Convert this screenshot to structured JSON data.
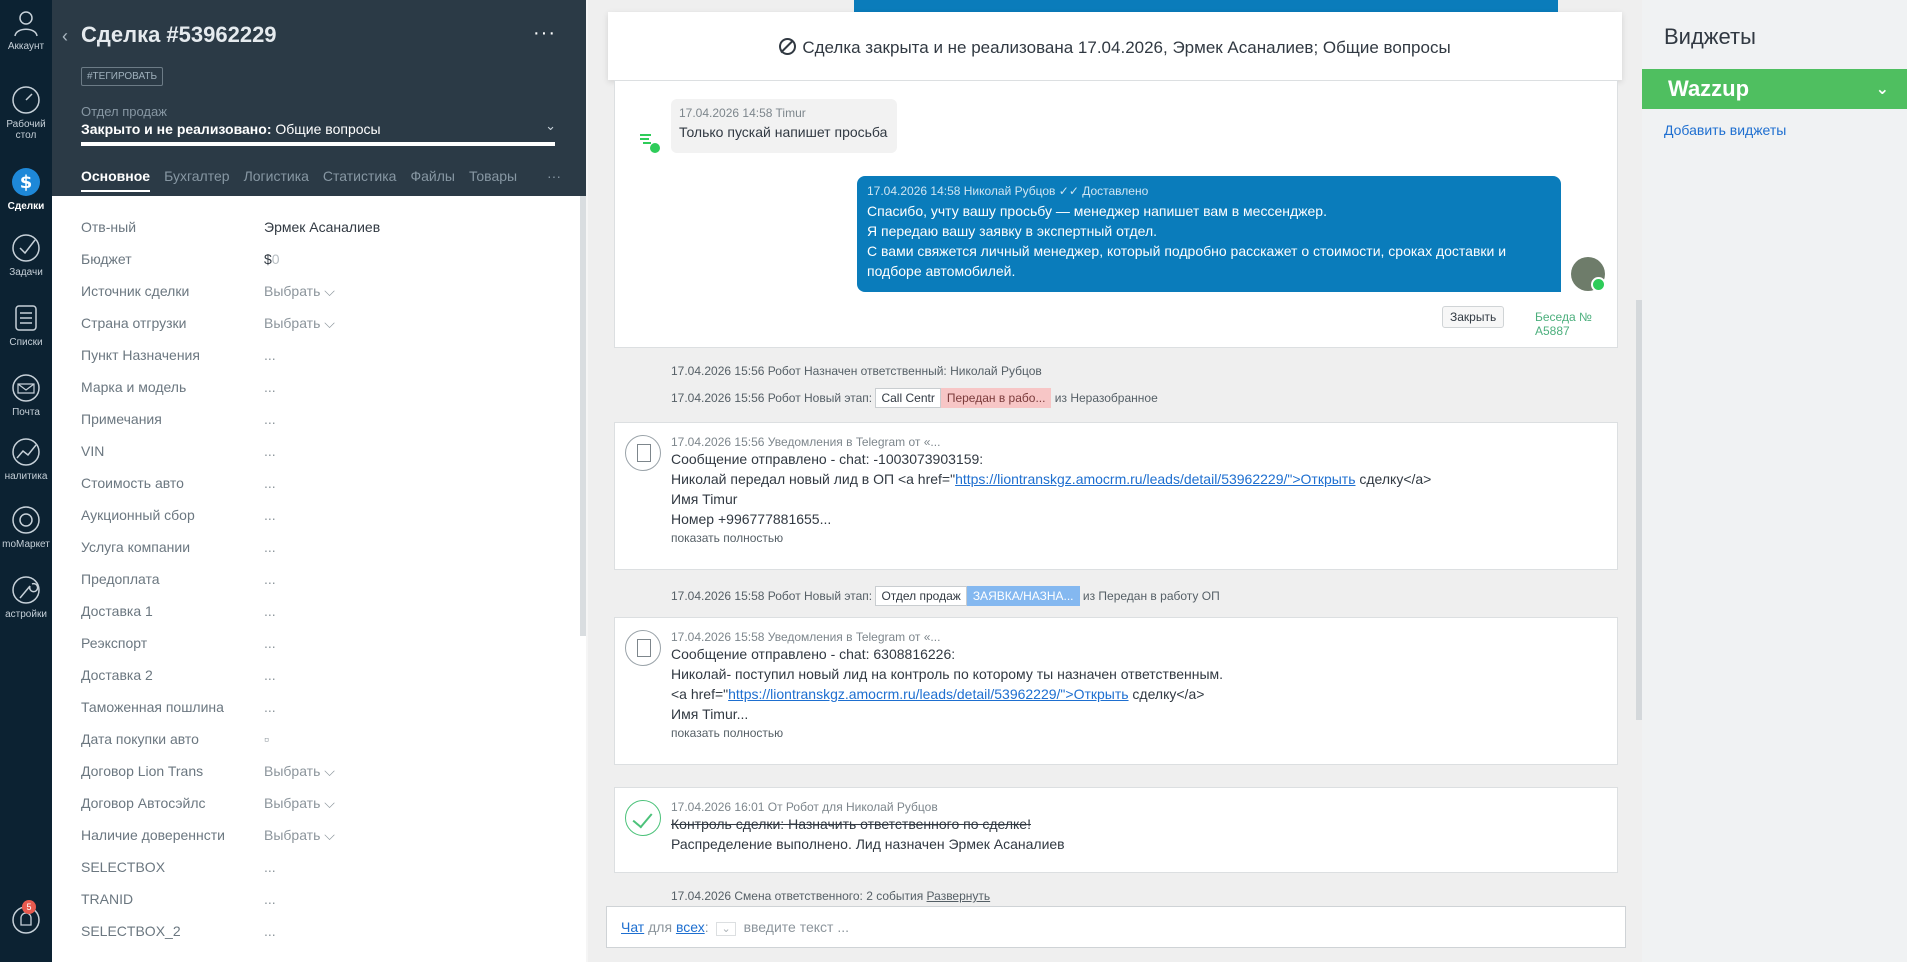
{
  "nav": [
    {
      "label": "Аккаунт",
      "icon": "account-icon"
    },
    {
      "label": "Рабочий стол",
      "icon": "dashboard-icon"
    },
    {
      "label": "Сделки",
      "icon": "deals-icon"
    },
    {
      "label": "Задачи",
      "icon": "tasks-icon"
    },
    {
      "label": "Списки",
      "icon": "lists-icon"
    },
    {
      "label": "Почта",
      "icon": "mail-icon"
    },
    {
      "label": "налитика",
      "icon": "analytics-icon"
    },
    {
      "label": "moМаркет",
      "icon": "market-icon"
    },
    {
      "label": "астройки",
      "icon": "settings-icon"
    }
  ],
  "nav_badge": "5",
  "deal": {
    "title": "Сделка #53962229",
    "more": "···",
    "tag_button": "#ТЕГИРОВАТЬ",
    "pipeline": "Отдел продаж",
    "stage_status": "Закрыто и не реализовано:",
    "stage_reason": " Общие вопросы",
    "tabs": [
      "Основное",
      "Бухгалтер",
      "Логистика",
      "Статистика",
      "Файлы",
      "Товары"
    ],
    "tabs_more": "···",
    "fields": [
      {
        "label": "Отв-ный",
        "value": "Эрмек Асаналиев"
      },
      {
        "label": "Бюджет",
        "value": "$",
        "value_suffix": "0"
      },
      {
        "label": "Источник сделки",
        "value": "Выбрать ⌵"
      },
      {
        "label": "Страна отгрузки",
        "value": "Выбрать ⌵"
      },
      {
        "label": "Пункт Назначения",
        "value": "..."
      },
      {
        "label": "Марка и модель",
        "value": "..."
      },
      {
        "label": "Примечания",
        "value": "..."
      },
      {
        "label": "VIN",
        "value": "..."
      },
      {
        "label": "Стоимость авто",
        "value": "..."
      },
      {
        "label": "Аукционный сбор",
        "value": "..."
      },
      {
        "label": "Услуга компании",
        "value": "..."
      },
      {
        "label": "Предоплата",
        "value": "..."
      },
      {
        "label": "Доставка 1",
        "value": "..."
      },
      {
        "label": "Реэкспорт",
        "value": "..."
      },
      {
        "label": "Доставка 2",
        "value": "..."
      },
      {
        "label": "Таможенная пошлина",
        "value": "..."
      },
      {
        "label": "Дата покупки авто",
        "value": "▫"
      },
      {
        "label": "Договор Lion Trans",
        "value": "Выбрать ⌵"
      },
      {
        "label": "Договор Автосэйлс",
        "value": "Выбрать ⌵"
      },
      {
        "label": "Наличие довереннсти",
        "value": "Выбрать ⌵"
      },
      {
        "label": "SELECTBOX",
        "value": "..."
      },
      {
        "label": "TRANID",
        "value": "..."
      },
      {
        "label": "SELECTBOX_2",
        "value": "..."
      }
    ]
  },
  "feed": {
    "closed_banner": "Сделка закрыта и не реализована 17.04.2026, Эрмек Асаналиев; Общие вопросы",
    "incoming": {
      "meta": "17.04.2026 14:58 Timur",
      "text": "Только пускай напишет просьба"
    },
    "outgoing": {
      "meta": "17.04.2026 14:58 Николай Рубцов ✓✓ Доставлено",
      "lines": [
        "Спасибо, учту вашу просьбу — менеджер напишет вам в мессенджер.",
        "Я передаю вашу заявку в экспертный отдел.",
        "С вами свяжется личный менеджер, который подробно расскажет о стоимости, сроках доставки и",
        "подборе автомобилей."
      ]
    },
    "close_button": "Закрыть",
    "conversation": "Беседа № A5887",
    "sys1": "17.04.2026 15:56 Робот Назначен ответственный: Николай Рубцов",
    "sys2_prefix": "17.04.2026 15:56 Робот Новый этап:",
    "sys2_from_pill": "Call Centr",
    "sys2_to_pill": "Передан в рабо...",
    "sys2_suffix": "из Неразобранное",
    "note1": {
      "meta": "17.04.2026 15:56 Уведомления в Telegram от «...",
      "line1": "Сообщение отправлено - chat: -1003073903159:",
      "line2_pre": "Николай передал новый лид в ОП <a href=\"",
      "line2_link": "https://liontranskgz.amocrm.ru/leads/detail/53962229/\">Открыть",
      "line2_post": " сделку</a>",
      "line3": "Имя Timur",
      "line4": "Номер +996777881655...",
      "show": "показать полностью"
    },
    "sys3_prefix": "17.04.2026 15:58 Робот Новый этап:",
    "sys3_from_pill": "Отдел продаж",
    "sys3_to_pill": "ЗАЯВКА/НАЗНА...",
    "sys3_suffix": "из Передан в работу ОП",
    "note2": {
      "meta": "17.04.2026 15:58 Уведомления в Telegram от «...",
      "line1": "Сообщение отправлено - chat: 6308816226:",
      "line2": "Николай- поступил новый лид на контроль по которому ты назначен ответственным.",
      "line3_pre": "<a href=\"",
      "line3_link": "https://liontranskgz.amocrm.ru/leads/detail/53962229/\">Открыть",
      "line3_post": " сделку</a>",
      "line4": "Имя Timur...",
      "show": "показать полностью"
    },
    "task": {
      "meta": "17.04.2026 16:01  От Робот для Николай Рубцов",
      "title": "Контроль сделки: Назначить ответственного по сделке!",
      "result": "Распределение выполнено. Лид назначен Эрмек Асаналиев"
    },
    "sys4_prefix": "17.04.2026 Смена ответственного: 2 события ",
    "sys4_link": "Развернуть",
    "input": {
      "chat": "Чат",
      "for": " для ",
      "all": "всех",
      "colon": ":",
      "placeholder": "введите текст ..."
    }
  },
  "widgets": {
    "title": "Виджеты",
    "wazzup": "Wazzup",
    "add": "Добавить виджеты"
  },
  "colors": {
    "nav_bg": "#0c2232",
    "deal_header": "#2b3a46",
    "outgoing_bubble": "#0a7cbb",
    "wazzup": "#4fbf60",
    "link": "#1e6fd0"
  }
}
